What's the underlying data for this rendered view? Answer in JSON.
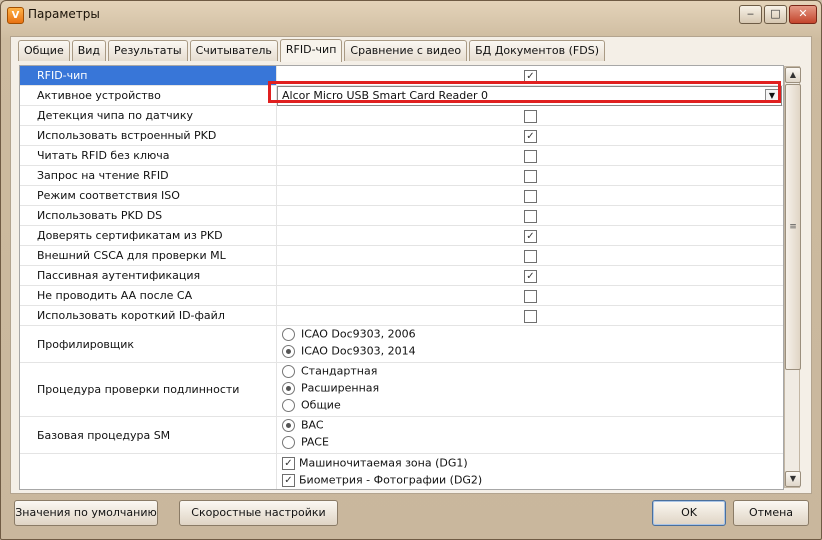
{
  "window": {
    "title": "Параметры",
    "app_icon": "app-logo-icon"
  },
  "titlebar_buttons": {
    "minimize": "‒",
    "maximize": "□",
    "close": "✕"
  },
  "tabs": [
    {
      "label": "Общие",
      "active": false
    },
    {
      "label": "Вид",
      "active": false
    },
    {
      "label": "Результаты",
      "active": false
    },
    {
      "label": "Считыватель",
      "active": false
    },
    {
      "label": "RFID-чип",
      "active": true
    },
    {
      "label": "Сравнение с видео",
      "active": false
    },
    {
      "label": "БД Документов (FDS)",
      "active": false
    }
  ],
  "properties": [
    {
      "label": "RFID-чип",
      "type": "check",
      "checked": true,
      "selected": true
    },
    {
      "label": "Активное устройство",
      "type": "combo",
      "value": "Alcor Micro USB Smart Card Reader 0"
    },
    {
      "label": "Детекция чипа по датчику",
      "type": "check",
      "checked": false
    },
    {
      "label": "Использовать встроенный PKD",
      "type": "check",
      "checked": true
    },
    {
      "label": "Читать RFID без ключа",
      "type": "check",
      "checked": false
    },
    {
      "label": "Запрос на чтение RFID",
      "type": "check",
      "checked": false
    },
    {
      "label": "Режим соответствия ISO",
      "type": "check",
      "checked": false
    },
    {
      "label": "Использовать PKD DS",
      "type": "check",
      "checked": false
    },
    {
      "label": "Доверять сертификатам из PKD",
      "type": "check",
      "checked": true
    },
    {
      "label": "Внешний CSCA для проверки ML",
      "type": "check",
      "checked": false
    },
    {
      "label": "Пассивная аутентификация",
      "type": "check",
      "checked": true
    },
    {
      "label": "Не проводить AA после CA",
      "type": "check",
      "checked": false
    },
    {
      "label": "Использовать короткий ID-файл",
      "type": "check",
      "checked": false
    },
    {
      "label": "Профилировщик",
      "type": "radio",
      "options": [
        {
          "label": "ICAO Doc9303, 2006",
          "selected": false
        },
        {
          "label": "ICAO Doc9303, 2014",
          "selected": true
        }
      ]
    },
    {
      "label": "Процедура проверки подлинности",
      "type": "radio",
      "options": [
        {
          "label": "Стандартная",
          "selected": false
        },
        {
          "label": "Расширенная",
          "selected": true
        },
        {
          "label": "Общие",
          "selected": false
        }
      ]
    },
    {
      "label": "Базовая процедура SM",
      "type": "radio",
      "options": [
        {
          "label": "BAC",
          "selected": true
        },
        {
          "label": "PACE",
          "selected": false
        }
      ]
    },
    {
      "label": "",
      "type": "checklist",
      "options": [
        {
          "label": "Машиночитаемая зона (DG1)",
          "checked": true
        },
        {
          "label": "Биометрия - Фотографии (DG2)",
          "checked": true
        }
      ]
    }
  ],
  "buttons": {
    "defaults": "Значения по умолчанию",
    "quick": "Скоростные настройки",
    "ok": "OK",
    "cancel": "Отмена"
  },
  "colors": {
    "selection": "#3876d8",
    "highlight_frame": "#e02020"
  }
}
